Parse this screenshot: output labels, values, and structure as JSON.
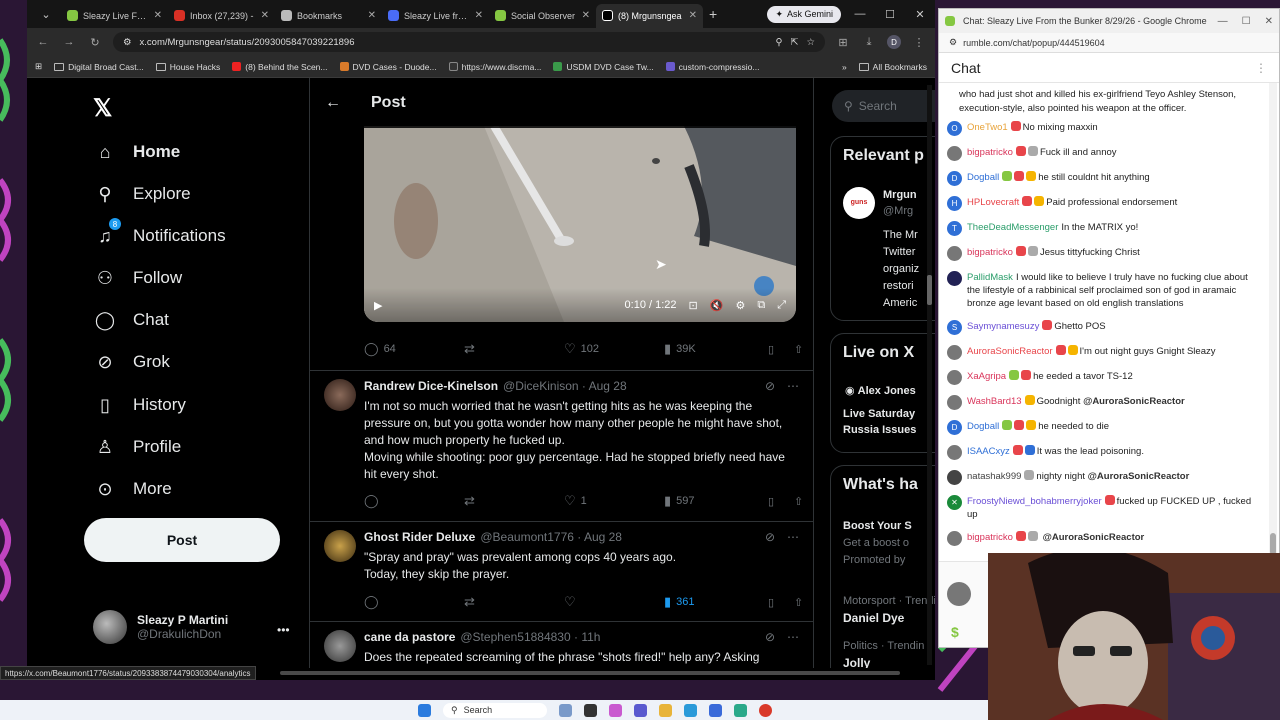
{
  "browser": {
    "tabs": [
      {
        "label": "Sleazy Live From",
        "color": "#85c742",
        "active": false
      },
      {
        "label": "Inbox (27,239) -",
        "color": "#d93025",
        "active": false
      },
      {
        "label": "Bookmarks",
        "color": "#bbbbbb",
        "active": false
      },
      {
        "label": "Sleazy Live from",
        "color": "#4a6cf7",
        "active": false
      },
      {
        "label": "Social Observer",
        "color": "#85c742",
        "active": false
      },
      {
        "label": "(8) Mrgunsngea",
        "color": "#ffffff",
        "active": true
      }
    ],
    "ask_gemini": "Ask Gemini",
    "url": "x.com/Mrgunsngear/status/2093005847039221896",
    "profile_letter": "D",
    "bookmarks": [
      {
        "label": "Digital Broad Cast...",
        "type": "folder"
      },
      {
        "label": "House Hacks",
        "type": "folder"
      },
      {
        "label": "(8) Behind the Scen...",
        "type": "youtube"
      },
      {
        "label": "DVD Cases - Duode...",
        "type": "site"
      },
      {
        "label": "https://www.discma...",
        "type": "site"
      },
      {
        "label": "USDM DVD Case Tw...",
        "type": "site"
      },
      {
        "label": "custom-compressio...",
        "type": "site"
      }
    ],
    "all_bookmarks": "All Bookmarks",
    "status_url": "https://x.com/Beaumont1776/status/2093383874479030304/analytics"
  },
  "x": {
    "nav": [
      {
        "label": "Home",
        "icon": "home-icon",
        "glyph": "⌂"
      },
      {
        "label": "Explore",
        "icon": "search-icon",
        "glyph": "⚲"
      },
      {
        "label": "Notifications",
        "icon": "bell-icon",
        "glyph": "🔔",
        "badge": "8"
      },
      {
        "label": "Follow",
        "icon": "follow-icon",
        "glyph": "👤"
      },
      {
        "label": "Chat",
        "icon": "chat-icon",
        "glyph": "💬"
      },
      {
        "label": "Grok",
        "icon": "grok-icon",
        "glyph": "⊘"
      },
      {
        "label": "History",
        "icon": "bookmark-icon",
        "glyph": "🔖"
      },
      {
        "label": "Profile",
        "icon": "profile-icon",
        "glyph": "👤"
      },
      {
        "label": "More",
        "icon": "more-icon",
        "glyph": "⋯"
      }
    ],
    "post_button": "Post",
    "user": {
      "name": "Sleazy P Martini",
      "handle": "@DrakulichDon"
    },
    "header_title": "Post",
    "video": {
      "time": "0:10 / 1:22"
    },
    "main_stats": {
      "replies": "64",
      "likes": "102",
      "views": "39K"
    },
    "replies": [
      {
        "name": "Randrew Dice-Kinelson",
        "handle": "@DiceKinison · Aug 28",
        "text": "I'm not so much worried that he wasn't getting hits as he was keeping the pressure on, but you gotta wonder how many other people he might have shot, and how much property he fucked up.",
        "text2": "Moving while shooting: poor guy percentage. Had he stopped briefly need have hit every shot.",
        "likes": "1",
        "views": "597"
      },
      {
        "name": "Ghost Rider Deluxe",
        "handle": "@Beaumont1776 · Aug 28",
        "text": "\"Spray and pray\" was prevalent among cops 40 years ago.",
        "text2": "Today, they skip the prayer.",
        "likes": "",
        "views": "361"
      },
      {
        "name": "cane da pastore",
        "handle": "@Stephen51884830 · 11h",
        "text": "Does the repeated screaming of the phrase \"shots fired!\" help any? Asking",
        "text2": "",
        "likes": "",
        "views": ""
      }
    ],
    "right": {
      "search_placeholder": "Search",
      "relevant_title": "Relevant p",
      "relevant_name": "Mrgun",
      "relevant_handle": "@Mrg",
      "relevant_lines": [
        "The Mr",
        "Twitter",
        "organiz",
        "restori",
        "Americ"
      ],
      "live_title": "Live on X",
      "live_host": "Alex Jones",
      "live_lines": [
        "Live Saturday",
        "Russia Issues"
      ],
      "whats_title": "What's ha",
      "trend1": "Boost Your S",
      "trend1b": "Get a boost o",
      "trend1c": "Promoted by",
      "trend2cat": "Motorsport · Trendi",
      "trend2": "Daniel Dye",
      "trend3cat": "Politics · Trendin",
      "trend3": "Jolly"
    }
  },
  "chat": {
    "window_title": "Chat: Sleazy Live From the Bunker 8/29/26 - Google Chrome",
    "url": "rumble.com/chat/popup/444519604",
    "header": "Chat",
    "prev_text": "who had just shot and killed his ex-girlfriend Teyo Ashley Stenson, execution-style, also pointed his weapon at the officer.",
    "messages": [
      {
        "user": "OneTwo1",
        "color": "#e8a33a",
        "avatar": "#2f6fd6",
        "letter": "O",
        "badges": [
          "#e8454a"
        ],
        "text": "No mixing maxxin"
      },
      {
        "user": "bigpatricko",
        "color": "#d9345a",
        "avatar": "#777777",
        "letter": "",
        "badges": [
          "#e8454a",
          "#aaaaaa"
        ],
        "text": "Fuck ill and annoy"
      },
      {
        "user": "Dogball",
        "color": "#2f6fd6",
        "avatar": "#2f6fd6",
        "letter": "D",
        "badges": [
          "#85c742",
          "#e8454a",
          "#f5b400"
        ],
        "text": "he still couldnt hit anything"
      },
      {
        "user": "HPLovecraft",
        "color": "#e8454a",
        "avatar": "#2f6fd6",
        "letter": "H",
        "badges": [
          "#e8454a",
          "#f5b400"
        ],
        "text": "Paid professional endorsement"
      },
      {
        "user": "TheeDeadMessenger",
        "color": "#2a9d6a",
        "avatar": "#2f6fd6",
        "letter": "T",
        "badges": [],
        "text": "In the MATRIX yo!"
      },
      {
        "user": "bigpatricko",
        "color": "#d9345a",
        "avatar": "#777777",
        "letter": "",
        "badges": [
          "#e8454a",
          "#aaaaaa"
        ],
        "text": "Jesus tittyfucking Christ"
      },
      {
        "user": "PallidMask",
        "color": "#2a9d6a",
        "avatar": "#222255",
        "letter": "",
        "badges": [],
        "text": "I would like to believe I truly have no fucking clue about the lifestyle of a rabbinical self proclaimed son of god in aramaic bronze age levant based on old english translations"
      },
      {
        "user": "Saymynamesuzy",
        "color": "#6a4fd6",
        "avatar": "#2f6fd6",
        "letter": "S",
        "badges": [
          "#e8454a"
        ],
        "text": "Ghetto POS"
      },
      {
        "user": "AuroraSonicReactor",
        "color": "#e8454a",
        "avatar": "#777777",
        "letter": "",
        "badges": [
          "#e8454a",
          "#f5b400"
        ],
        "text": "I'm out night guys Gnight Sleazy"
      },
      {
        "user": "XaAgripa",
        "color": "#d9345a",
        "avatar": "#777777",
        "letter": "",
        "badges": [
          "#85c742",
          "#e8454a"
        ],
        "text": "he eeded a tavor TS-12"
      },
      {
        "user": "WashBard13",
        "color": "#d9345a",
        "avatar": "#777777",
        "letter": "",
        "badges": [
          "#f5b400"
        ],
        "text": "Goodnight",
        "mention": "@AuroraSonicReactor"
      },
      {
        "user": "Dogball",
        "color": "#2f6fd6",
        "avatar": "#2f6fd6",
        "letter": "D",
        "badges": [
          "#85c742",
          "#e8454a",
          "#f5b400"
        ],
        "text": "he needed to die"
      },
      {
        "user": "ISAACxyz",
        "color": "#2f6fd6",
        "avatar": "#777777",
        "letter": "",
        "badges": [
          "#e8454a",
          "#2f6fd6"
        ],
        "text": "It was the lead poisoning."
      },
      {
        "user": "natashak999",
        "color": "#444444",
        "avatar": "#444444",
        "letter": "",
        "badges": [
          "#aaaaaa"
        ],
        "text": "nighty night",
        "mention": "@AuroraSonicReactor"
      },
      {
        "user": "FroostyNiewd_bohabmerryjoker",
        "color": "#6a4fd6",
        "avatar": "#1a8a3a",
        "letter": "✕",
        "badges": [
          "#e8454a"
        ],
        "text": "fucked up FUCKED UP , fucked up"
      },
      {
        "user": "bigpatricko",
        "color": "#d9345a",
        "avatar": "#777777",
        "letter": "",
        "badges": [
          "#e8454a",
          "#aaaaaa"
        ],
        "text": "",
        "mention": "@AuroraSonicReactor"
      }
    ],
    "dollar": "$"
  },
  "taskbar": {
    "search": "Search"
  }
}
